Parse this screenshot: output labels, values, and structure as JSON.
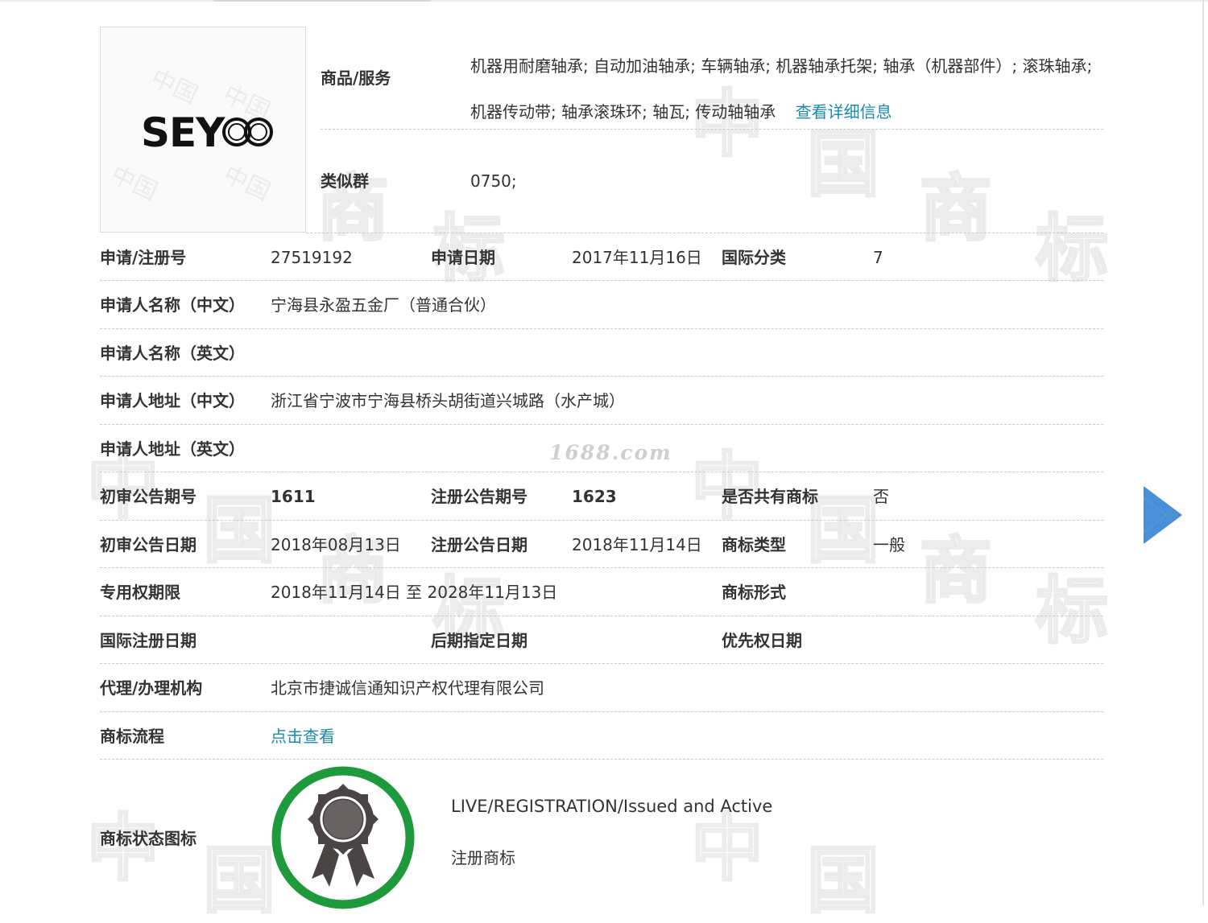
{
  "logo": {
    "text": "SEYOO"
  },
  "watermark": {
    "chars": [
      "中",
      "国",
      "商",
      "标"
    ],
    "site": "1688.com"
  },
  "goods": {
    "label": "商品/服务",
    "text": "机器用耐磨轴承; 自动加油轴承; 车辆轴承; 机器轴承托架; 轴承（机器部件）; 滚珠轴承; 机器传动带; 轴承滚珠环; 轴瓦; 传动轴轴承",
    "detail_link": "查看详细信息"
  },
  "similar_group": {
    "label": "类似群",
    "value": "0750;"
  },
  "fields": {
    "reg_no_label": "申请/注册号",
    "reg_no": "27519192",
    "apply_date_label": "申请日期",
    "apply_date": "2017年11月16日",
    "intl_class_label": "国际分类",
    "intl_class": "7",
    "applicant_cn_label": "申请人名称（中文）",
    "applicant_cn": "宁海县永盈五金厂（普通合伙）",
    "applicant_en_label": "申请人名称（英文）",
    "applicant_en": "",
    "address_cn_label": "申请人地址（中文）",
    "address_cn": "浙江省宁波市宁海县桥头胡街道兴城路（水产城）",
    "address_en_label": "申请人地址（英文）",
    "address_en": "",
    "prelim_no_label": "初审公告期号",
    "prelim_no": "1611",
    "reg_pub_no_label": "注册公告期号",
    "reg_pub_no": "1623",
    "shared_label": "是否共有商标",
    "shared": "否",
    "prelim_date_label": "初审公告日期",
    "prelim_date": "2018年08月13日",
    "reg_pub_date_label": "注册公告日期",
    "reg_pub_date": "2018年11月14日",
    "tm_type_label": "商标类型",
    "tm_type": "一般",
    "exclusive_label": "专用权期限",
    "exclusive": "2018年11月14日 至 2028年11月13日",
    "tm_form_label": "商标形式",
    "tm_form": "",
    "intl_reg_date_label": "国际注册日期",
    "later_date_label": "后期指定日期",
    "priority_date_label": "优先权日期",
    "agent_label": "代理/办理机构",
    "agent": "北京市捷诚信通知识产权代理有限公司",
    "process_label": "商标流程",
    "process_link": "点击查看",
    "status_icon_label": "商标状态图标",
    "status_en": "LIVE/REGISTRATION/Issued and Active",
    "status_cn": "注册商标"
  },
  "colors": {
    "link": "#1a8ab0",
    "status_ring": "#1e9a3c",
    "arrow": "#4a90d9",
    "rosette": "#4a4444"
  },
  "icons": [
    "award-rosette-icon",
    "next-arrow-icon"
  ]
}
